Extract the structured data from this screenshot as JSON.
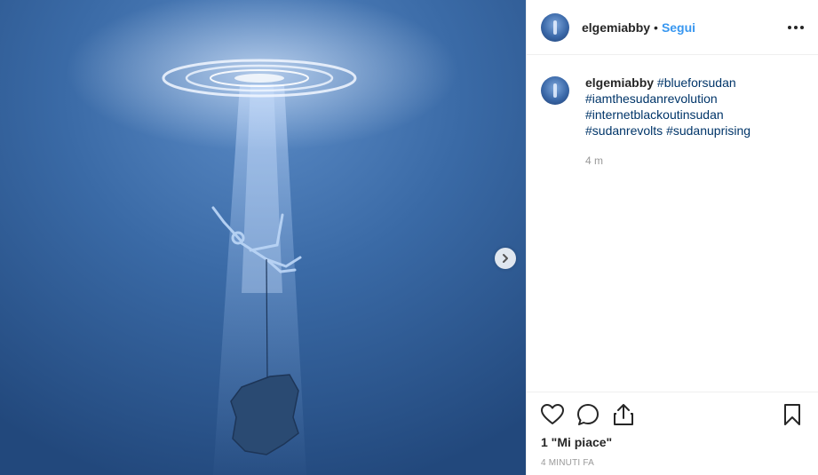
{
  "post": {
    "username": "elgemiabby",
    "separator": "•",
    "follow_label": "Segui",
    "more_icon": "more-options-icon",
    "image_alt": "underwater illustration of a figure tethered to a rock, sinking beneath a ring of light",
    "next_icon": "chevron-right-icon"
  },
  "caption": {
    "username": "elgemiabby",
    "hashtags": [
      "#blueforsudan",
      "#iamthesudanrevolution",
      "#internetblackoutinsudan",
      "#sudanrevolts",
      "#sudanuprising"
    ],
    "time": "4 m"
  },
  "actions": {
    "like_icon": "heart-icon",
    "comment_icon": "comment-icon",
    "share_icon": "share-icon",
    "save_icon": "bookmark-icon",
    "likes_text": "1 \"Mi piace\"",
    "date_text": "4 MINUTI FA"
  },
  "colors": {
    "follow": "#3897f0",
    "hashtag": "#003569",
    "water": "#2f5c93"
  }
}
